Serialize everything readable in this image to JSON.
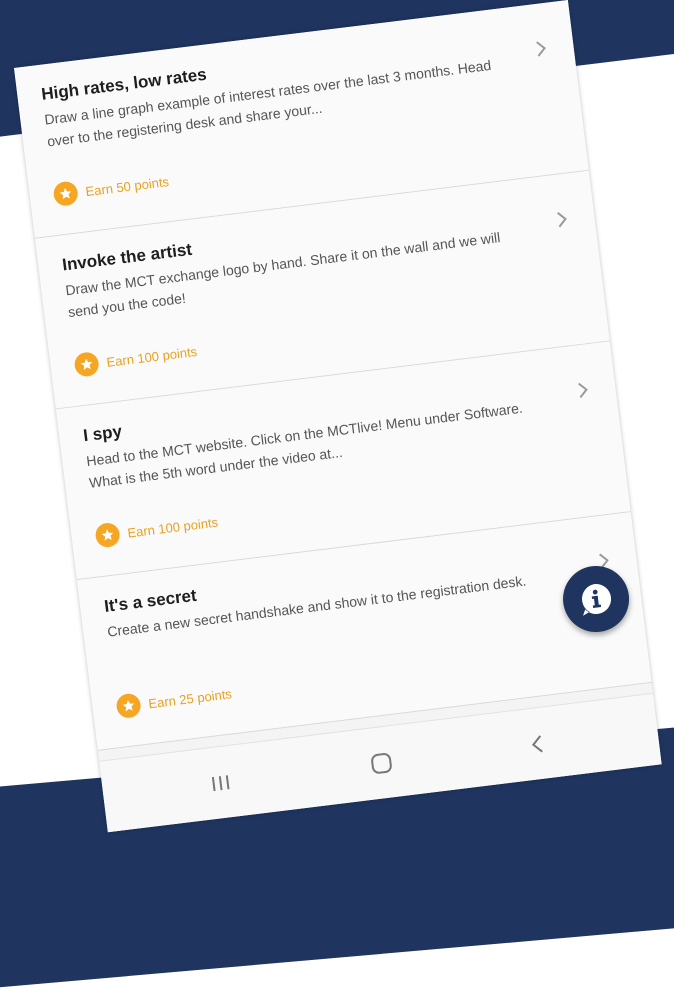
{
  "challenges": [
    {
      "title": "High rates, low rates",
      "description": "Draw a line graph example of interest rates over the last 3 months. Head over to the registering desk and share your...",
      "reward": "Earn 50 points"
    },
    {
      "title": "Invoke the artist",
      "description": "Draw the MCT exchange logo by hand. Share it on the wall and we will send you the code!",
      "reward": "Earn 100 points"
    },
    {
      "title": "I spy",
      "description": "Head to the MCT website. Click on the MCTlive! Menu under Software. What is the 5th word under the video at...",
      "reward": "Earn 100 points"
    },
    {
      "title": "It's a secret",
      "description": "Create a new secret handshake and show it to the registration desk.",
      "reward": "Earn 25 points"
    }
  ],
  "icons": {
    "chevron": "chevron-right-icon",
    "reward": "star-badge-icon",
    "fab": "info-chat-icon",
    "nav": [
      "recent-apps-icon",
      "home-icon",
      "back-icon"
    ]
  },
  "colors": {
    "navy": "#1f3560",
    "reward_orange": "#f5a623",
    "reward_text": "#e8a21e"
  }
}
